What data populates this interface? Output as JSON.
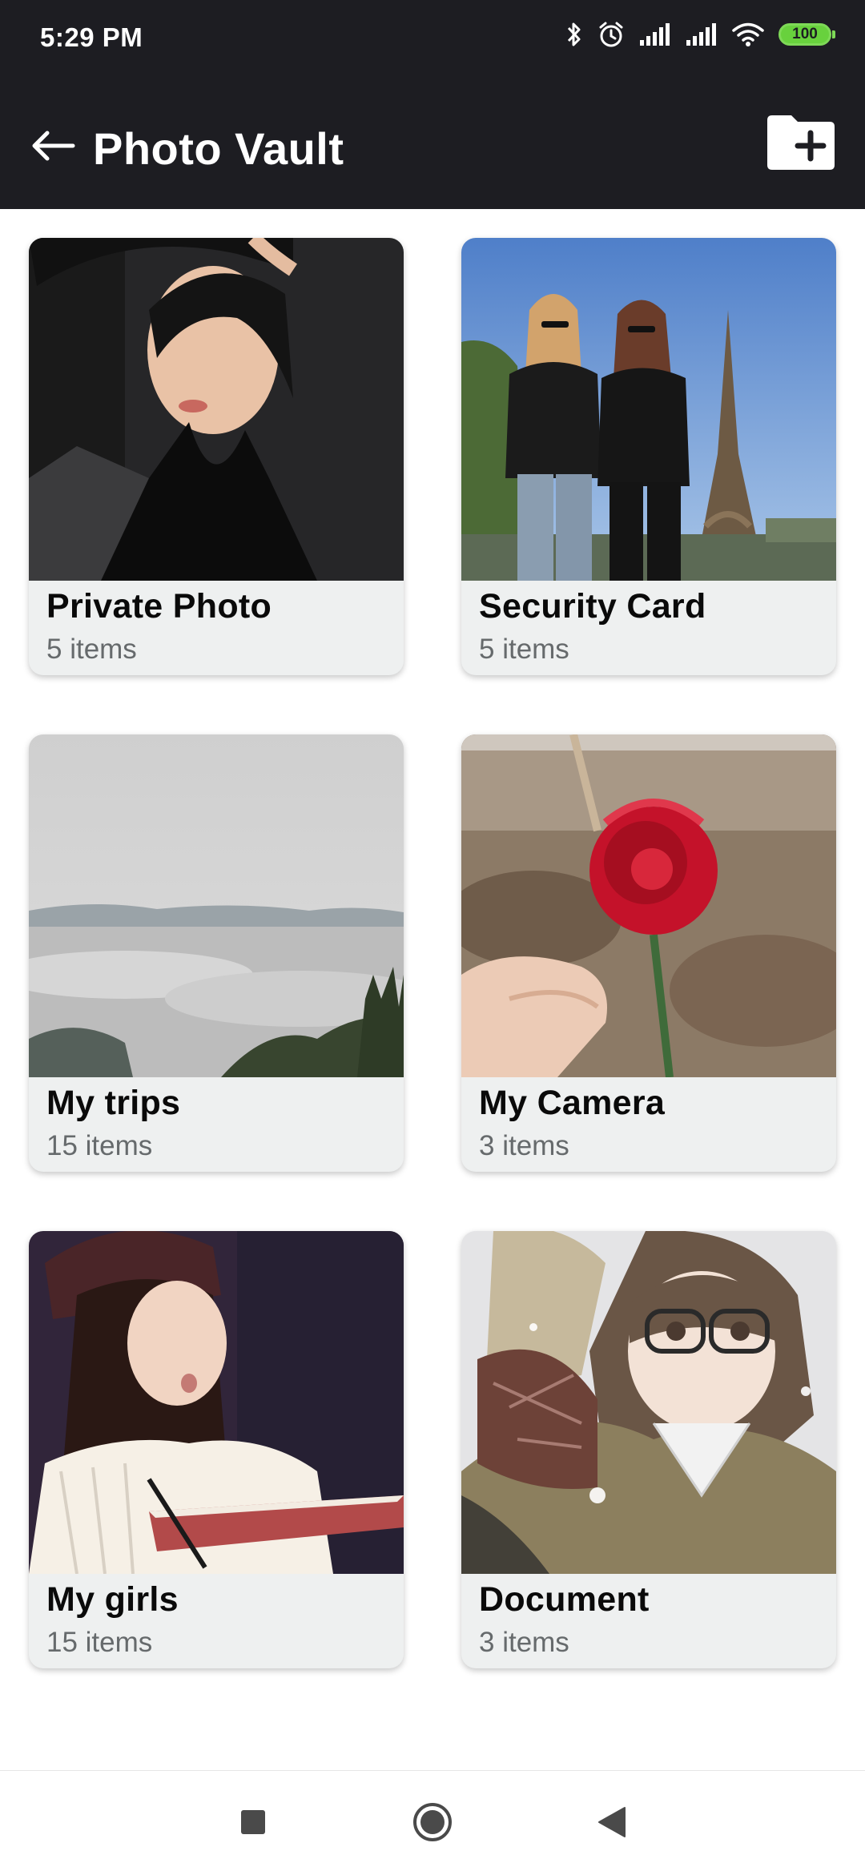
{
  "status_bar": {
    "time": "5:29 PM",
    "battery": "100",
    "icons": [
      "bluetooth-icon",
      "alarm-icon",
      "signal-icon",
      "signal-icon",
      "wifi-icon",
      "battery-icon"
    ]
  },
  "app_bar": {
    "title": "Photo Vault",
    "back_icon": "arrow-left-icon",
    "action_icon": "folder-plus-icon"
  },
  "albums": [
    {
      "name": "Private Photo",
      "count": "5 items"
    },
    {
      "name": "Security Card",
      "count": "5 items"
    },
    {
      "name": "My trips",
      "count": "15 items"
    },
    {
      "name": "My Camera",
      "count": "3 items"
    },
    {
      "name": "My girls",
      "count": "15 items"
    },
    {
      "name": "Document",
      "count": "3 items"
    }
  ],
  "nav_bar": {
    "icons": [
      "recents-square-icon",
      "home-circle-icon",
      "back-triangle-icon"
    ]
  },
  "colors": {
    "bar_background": "#1d1d22",
    "card_background": "#eef0f0",
    "battery": "#68d13d"
  }
}
